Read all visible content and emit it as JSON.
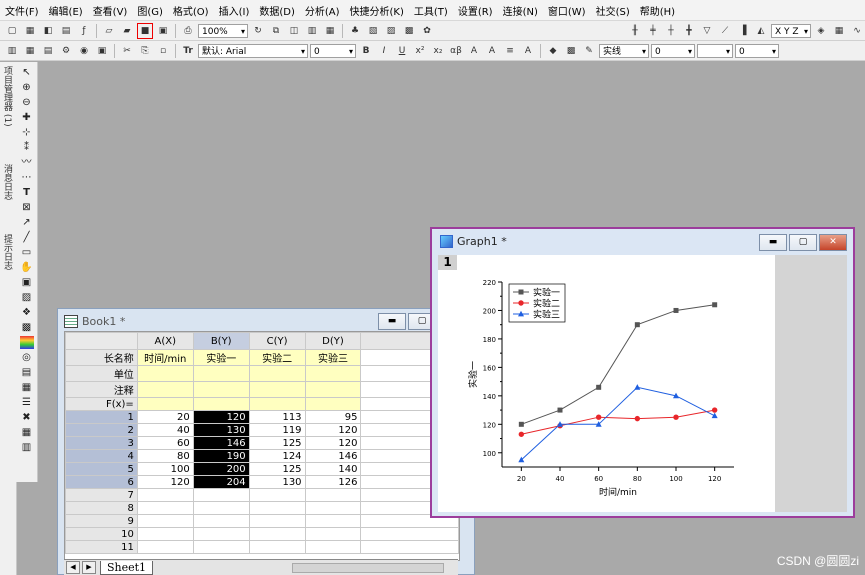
{
  "menu": [
    "文件(F)",
    "编辑(E)",
    "查看(V)",
    "图(G)",
    "格式(O)",
    "插入(I)",
    "数据(D)",
    "分析(A)",
    "快捷分析(K)",
    "工具(T)",
    "设置(R)",
    "连接(N)",
    "窗口(W)",
    "社交(S)",
    "帮助(H)"
  ],
  "toolbar": {
    "zoom": "100%",
    "font": "默认: Arial",
    "size": "0",
    "line_label": "实线",
    "num1": "0",
    "num2": "0",
    "xyz": "X Y Z"
  },
  "left_tabs": {
    "project": "项目管理器 (1)",
    "messages": "消息日志",
    "hints": "提示日志"
  },
  "book": {
    "title": "Book1 *",
    "columns": [
      "A(X)",
      "B(Y)",
      "C(Y)",
      "D(Y)"
    ],
    "meta_labels": [
      "长名称",
      "单位",
      "注释",
      "F(x)="
    ],
    "long_names": [
      "时间/min",
      "实验一",
      "实验二",
      "实验三"
    ],
    "row_numbers": [
      "1",
      "2",
      "3",
      "4",
      "5",
      "6",
      "7",
      "8",
      "9",
      "10",
      "11"
    ],
    "data": [
      [
        "20",
        "120",
        "113",
        "95"
      ],
      [
        "40",
        "130",
        "119",
        "120"
      ],
      [
        "60",
        "146",
        "125",
        "120"
      ],
      [
        "80",
        "190",
        "124",
        "146"
      ],
      [
        "100",
        "200",
        "125",
        "140"
      ],
      [
        "120",
        "204",
        "130",
        "126"
      ]
    ],
    "sheet_tab": "Sheet1"
  },
  "graph": {
    "title": "Graph1 *",
    "layer": "1"
  },
  "chart_data": {
    "type": "line",
    "x": [
      20,
      40,
      60,
      80,
      100,
      120
    ],
    "xlabel": "时间/min",
    "ylabel": "实验一",
    "xlim": [
      10,
      130
    ],
    "ylim": [
      90,
      220
    ],
    "xticks": [
      20,
      40,
      60,
      80,
      100,
      120
    ],
    "yticks": [
      100,
      120,
      140,
      160,
      180,
      200,
      220
    ],
    "legend_position": "top-left",
    "series": [
      {
        "name": "实验一",
        "values": [
          120,
          130,
          146,
          190,
          200,
          204
        ],
        "color": "#555555",
        "marker": "square"
      },
      {
        "name": "实验二",
        "values": [
          113,
          119,
          125,
          124,
          125,
          130
        ],
        "color": "#e8262a",
        "marker": "circle"
      },
      {
        "name": "实验三",
        "values": [
          95,
          120,
          120,
          146,
          140,
          126
        ],
        "color": "#1f5fe0",
        "marker": "triangle"
      }
    ]
  },
  "watermark": "CSDN @圆圆zi"
}
